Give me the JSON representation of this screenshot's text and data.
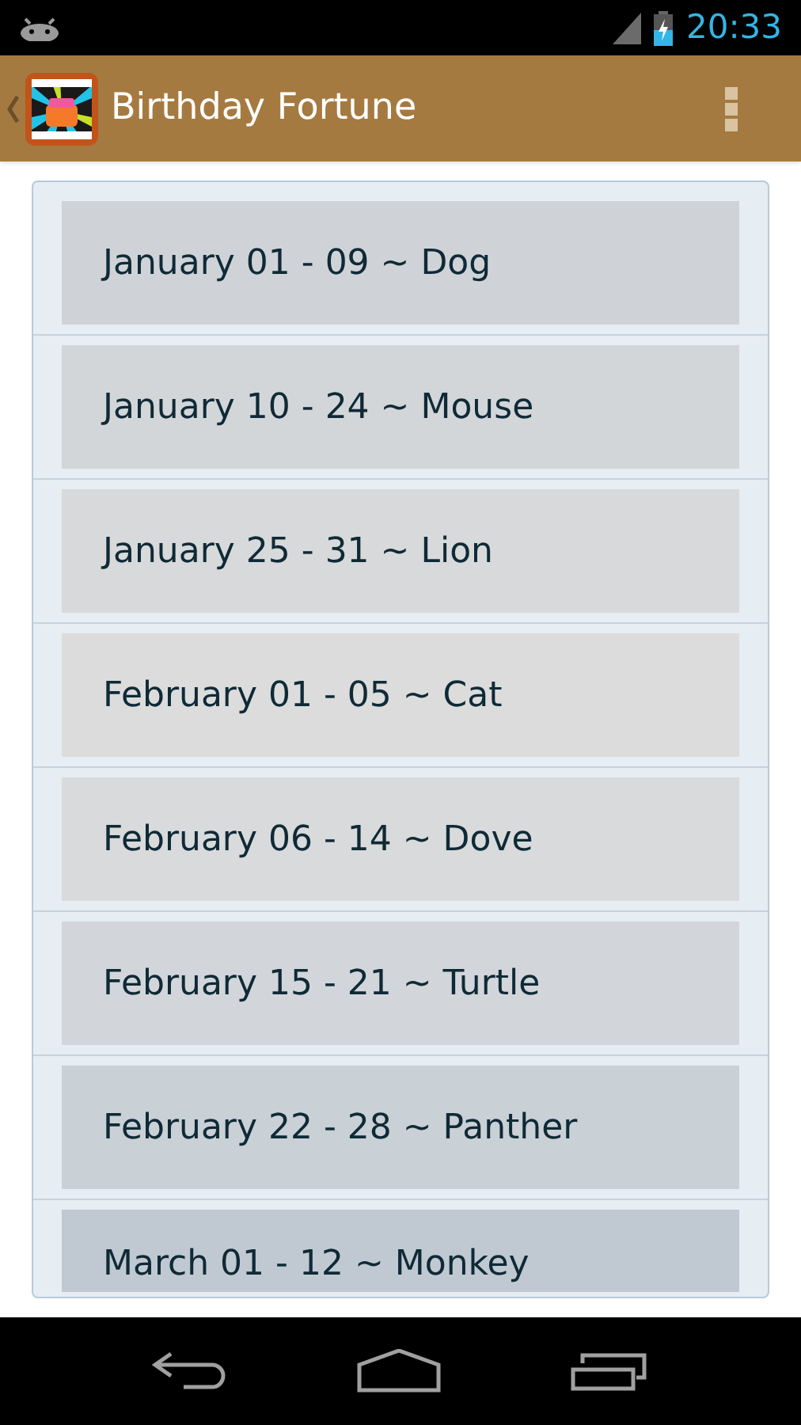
{
  "status_bar": {
    "time": "20:33"
  },
  "action_bar": {
    "title": "Birthday Fortune"
  },
  "list": [
    {
      "label": "January 01 - 09 ~ Dog"
    },
    {
      "label": "January 10 - 24 ~ Mouse"
    },
    {
      "label": "January 25 - 31 ~ Lion"
    },
    {
      "label": "February 01 - 05 ~ Cat"
    },
    {
      "label": "February 06 - 14 ~ Dove"
    },
    {
      "label": "February 15 - 21 ~ Turtle"
    },
    {
      "label": "February 22 - 28 ~ Panther"
    },
    {
      "label": "March 01 - 12 ~ Monkey"
    }
  ]
}
